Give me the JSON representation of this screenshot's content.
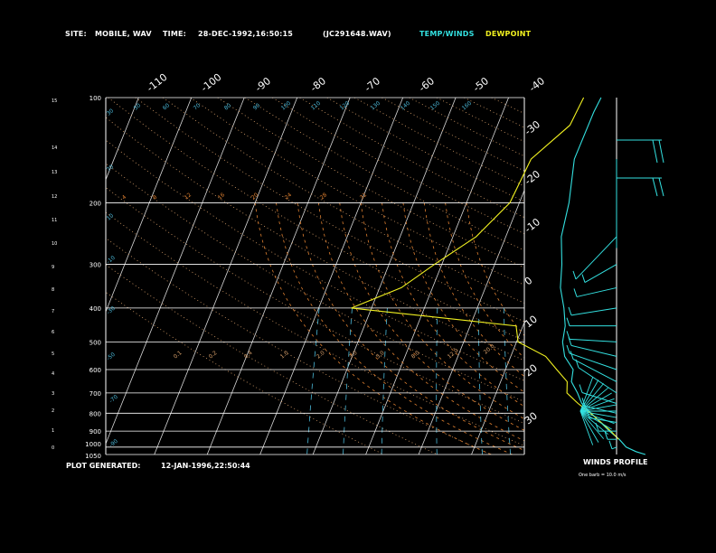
{
  "header": {
    "site_label": "SITE:",
    "site_value": "MOBILE, WAV",
    "time_label": "TIME:",
    "time_value": "28-DEC-1992,16:50:15",
    "file_id": "(JC291648.WAV)",
    "legend_temp": "TEMP/WINDS",
    "legend_dew": "DEWPOINT"
  },
  "footer": {
    "generated_label": "PLOT GENERATED:",
    "generated_value": "12-JAN-1996,22:50:44",
    "winds_title": "WINDS PROFILE",
    "winds_note": "One barb = 10.0 m/s"
  },
  "colors": {
    "background": "#000000",
    "frame": "#ffffff",
    "temp": "#33e0e0",
    "dew": "#f0f020",
    "isotherm": "#d8d8d8",
    "dry_adiabat": "#d9a06a",
    "moist_adiabat": "#e08030",
    "mixing_ratio": "#4ab8d8",
    "wind": "#33e0e0"
  },
  "chart_data": {
    "type": "line",
    "title": "",
    "ylabel": "",
    "pressure_labels": [
      "100",
      "200",
      "300",
      "400",
      "500",
      "600",
      "700",
      "800",
      "900",
      "1000",
      "1050"
    ],
    "pressure_levels": [
      100,
      200,
      300,
      400,
      500,
      600,
      700,
      800,
      900,
      1000,
      1050
    ],
    "height_labels": [
      "0",
      "1",
      "2",
      "3",
      "4",
      "5",
      "6",
      "7",
      "8",
      "9",
      "10",
      "11",
      "12",
      "13",
      "14",
      "15"
    ],
    "top_temp_labels": [
      "-110",
      "-100",
      "-90",
      "-80",
      "-70",
      "-60",
      "-50",
      "-40"
    ],
    "right_temp_labels": [
      "-30",
      "-20",
      "-10",
      "0",
      "10",
      "20",
      "30"
    ],
    "mixing_ratio_labels": [
      "0.1",
      "0.2",
      "0.4",
      "1.0",
      "2.0",
      "3.0",
      "5.0",
      "8.0",
      "12.0",
      "20.0"
    ],
    "theta_labels": [
      "30",
      "50",
      "60",
      "70",
      "80",
      "90",
      "100",
      "110",
      "120",
      "130",
      "140",
      "150",
      "160"
    ],
    "thetae_labels": [
      "4",
      "8",
      "12",
      "16",
      "20",
      "24",
      "28",
      "32"
    ],
    "series": [
      {
        "name": "TEMP/WINDS",
        "x": [
          -12.5,
          -12.8,
          -12.9,
          -10.6,
          -9.5,
          -7.3,
          -5.8,
          -3.6,
          -2.0,
          -1.3,
          0.2,
          2.8,
          3.4,
          5.4,
          7.0,
          9.5,
          12.0,
          14.3,
          16.8,
          18.7,
          20.9,
          22.9
        ],
        "y": [
          100,
          110,
          150,
          200,
          250,
          300,
          350,
          400,
          450,
          500,
          550,
          600,
          650,
          700,
          750,
          800,
          850,
          900,
          950,
          1000,
          1030,
          1050
        ]
      },
      {
        "name": "DEWPOINT",
        "x": [
          -15.8,
          -16.3,
          -21.1,
          -21.8,
          -25.6,
          -31.4,
          -35.9,
          -43.8,
          -11.3,
          -9.7,
          -3.4,
          -0.3,
          2.6,
          3.4,
          6.3,
          9.4,
          12.1,
          14.6,
          16.7
        ],
        "y": [
          100,
          120,
          150,
          200,
          250,
          300,
          350,
          400,
          450,
          500,
          550,
          600,
          650,
          700,
          750,
          800,
          850,
          900,
          950
        ]
      }
    ],
    "wind_levels_mb": [
      100,
      150,
      200,
      250,
      300,
      350,
      400,
      450,
      500,
      550,
      600,
      650,
      700,
      750,
      800,
      850,
      900,
      950,
      1000
    ]
  }
}
